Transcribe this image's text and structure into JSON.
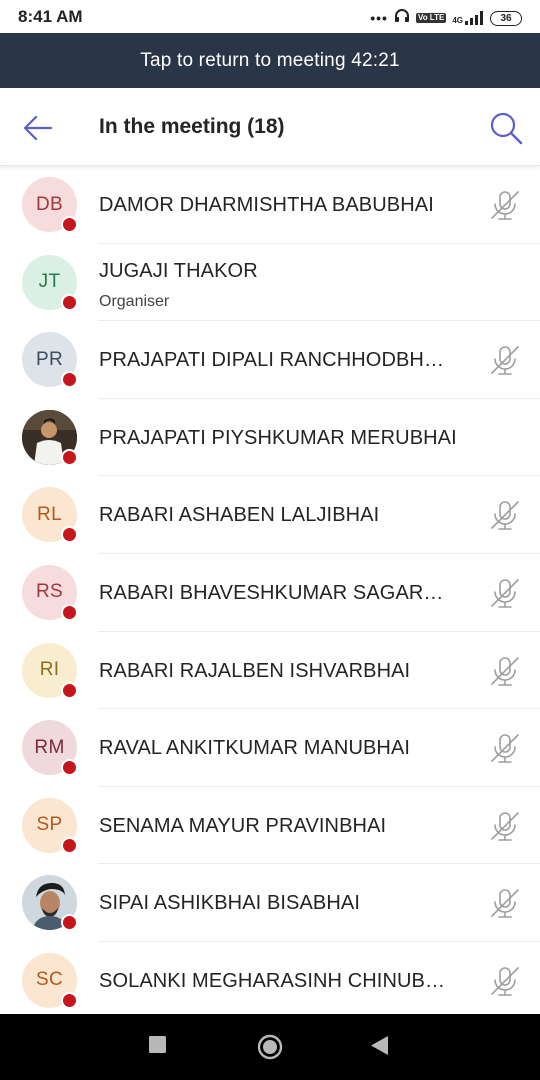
{
  "status_bar": {
    "time": "8:41 AM",
    "dots": "•••",
    "volte": "Vo LTE",
    "network": "4G",
    "battery": "36"
  },
  "banner": {
    "text": "Tap to return to meeting 42:21"
  },
  "header": {
    "title": "In the meeting (18)"
  },
  "participants": [
    {
      "initials": "DB",
      "name": "DAMOR DHARMISHTHA BABUBHAI",
      "avatar_bg": "#f6dcdc",
      "avatar_fg": "#a4373a",
      "muted": true
    },
    {
      "initials": "JT",
      "name": "JUGAJI THAKOR",
      "role": "Organiser",
      "avatar_bg": "#dbf0e4",
      "avatar_fg": "#237b4b",
      "muted": false
    },
    {
      "initials": "PR",
      "name": "PRAJAPATI DIPALI RANCHHODBH…",
      "avatar_bg": "#dde3e8",
      "avatar_fg": "#3b4d5e",
      "muted": true
    },
    {
      "initials": "",
      "name": "PRAJAPATI PIYSHKUMAR MERUBHAI",
      "photo": "man-in-white-photo",
      "muted": false
    },
    {
      "initials": "RL",
      "name": "RABARI ASHABEN LALJIBHAI",
      "avatar_bg": "#fbe6d2",
      "avatar_fg": "#b35a1a",
      "muted": true
    },
    {
      "initials": "RS",
      "name": "RABARI BHAVESHKUMAR SAGAR…",
      "avatar_bg": "#f6dcdc",
      "avatar_fg": "#a4373a",
      "muted": true
    },
    {
      "initials": "RI",
      "name": "RABARI RAJALBEN ISHVARBHAI",
      "avatar_bg": "#f9edd0",
      "avatar_fg": "#8f6d1a",
      "muted": true
    },
    {
      "initials": "RM",
      "name": "RAVAL ANKITKUMAR MANUBHAI",
      "avatar_bg": "#efd9dc",
      "avatar_fg": "#7d2a38",
      "muted": true
    },
    {
      "initials": "SP",
      "name": "SENAMA MAYUR PRAVINBHAI",
      "avatar_bg": "#fbe6d2",
      "avatar_fg": "#b35a1a",
      "muted": true
    },
    {
      "initials": "",
      "name": "SIPAI ASHIKBHAI BISABHAI",
      "photo": "man-selfie-photo",
      "muted": true
    },
    {
      "initials": "SC",
      "name": "SOLANKI MEGHARASINH CHINUB…",
      "avatar_bg": "#fbe6d2",
      "avatar_fg": "#b35a1a",
      "muted": true
    }
  ],
  "colors": {
    "accent": "#5b5fc7",
    "banner_bg": "#2b3548",
    "presence_busy": "#c4161c",
    "mic_off": "#9e9e9e"
  },
  "icons": {
    "back": "back-arrow-icon",
    "search": "search-icon",
    "mic_off": "mic-off-icon",
    "nav_recents": "square-icon",
    "nav_home": "circle-icon",
    "nav_back": "triangle-icon"
  }
}
